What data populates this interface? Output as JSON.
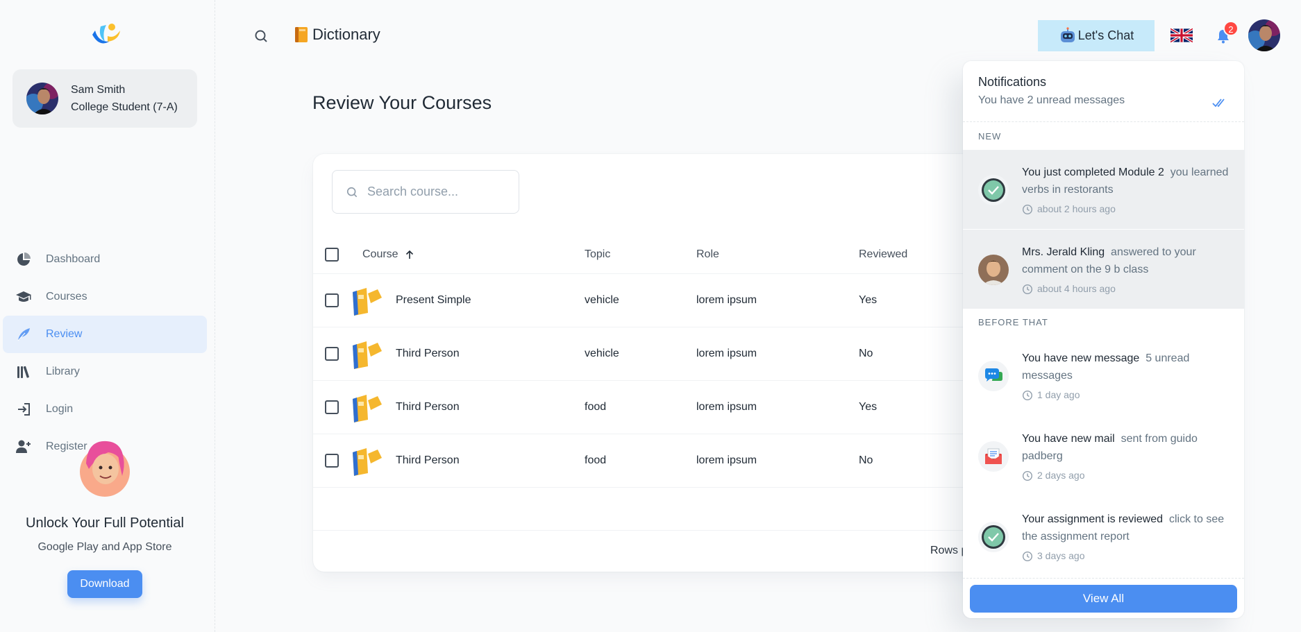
{
  "account": {
    "name": "Sam Smith",
    "role": "College Student (7-A)"
  },
  "nav": [
    {
      "label": "Dashboard",
      "icon": "pie-chart-icon"
    },
    {
      "label": "Courses",
      "icon": "graduation-cap-icon"
    },
    {
      "label": "Review",
      "icon": "feather-icon"
    },
    {
      "label": "Library",
      "icon": "library-icon"
    },
    {
      "label": "Login",
      "icon": "login-icon"
    },
    {
      "label": "Register",
      "icon": "add-user-icon"
    }
  ],
  "promo": {
    "title": "Unlock Your Full Potential",
    "subtitle": "Google Play and App Store",
    "button": "Download"
  },
  "header": {
    "title": "Dictionary",
    "chat_label": "Let's Chat",
    "notification_count": "2"
  },
  "page": {
    "title": "Review Your Courses"
  },
  "search": {
    "placeholder": "Search course..."
  },
  "table": {
    "columns": [
      "Course",
      "Topic",
      "Role",
      "Reviewed"
    ],
    "rows": [
      {
        "course": "Present Simple",
        "topic": "vehicle",
        "role": "lorem ipsum",
        "reviewed": "Yes"
      },
      {
        "course": "Third Person",
        "topic": "vehicle",
        "role": "lorem ipsum",
        "reviewed": "No"
      },
      {
        "course": "Third Person",
        "topic": "food",
        "role": "lorem ipsum",
        "reviewed": "Yes"
      },
      {
        "course": "Third Person",
        "topic": "food",
        "role": "lorem ipsum",
        "reviewed": "No"
      }
    ],
    "rows_per_page_label": "Rows p"
  },
  "notifications": {
    "title": "Notifications",
    "subtitle": "You have 2 unread messages",
    "section_new": "NEW",
    "section_before": "BEFORE THAT",
    "view_all": "View All",
    "items": [
      {
        "title": "You just completed Module 2",
        "detail": "you learned verbs in restorants",
        "time": "about 2 hours ago",
        "icon": "check-circle-icon"
      },
      {
        "title": "Mrs. Jerald Kling",
        "detail": "answered to your comment on the 9 b class",
        "time": "about 4 hours ago",
        "icon": "user-avatar"
      },
      {
        "title": "You have new message",
        "detail": "5 unread messages",
        "time": "1 day ago",
        "icon": "chat-bubble-icon"
      },
      {
        "title": "You have new mail",
        "detail": "sent from guido padberg",
        "time": "2 days ago",
        "icon": "mail-icon"
      },
      {
        "title": "Your assignment is reviewed",
        "detail": "click to see the assignment report",
        "time": "3 days ago",
        "icon": "check-circle-icon"
      }
    ]
  }
}
